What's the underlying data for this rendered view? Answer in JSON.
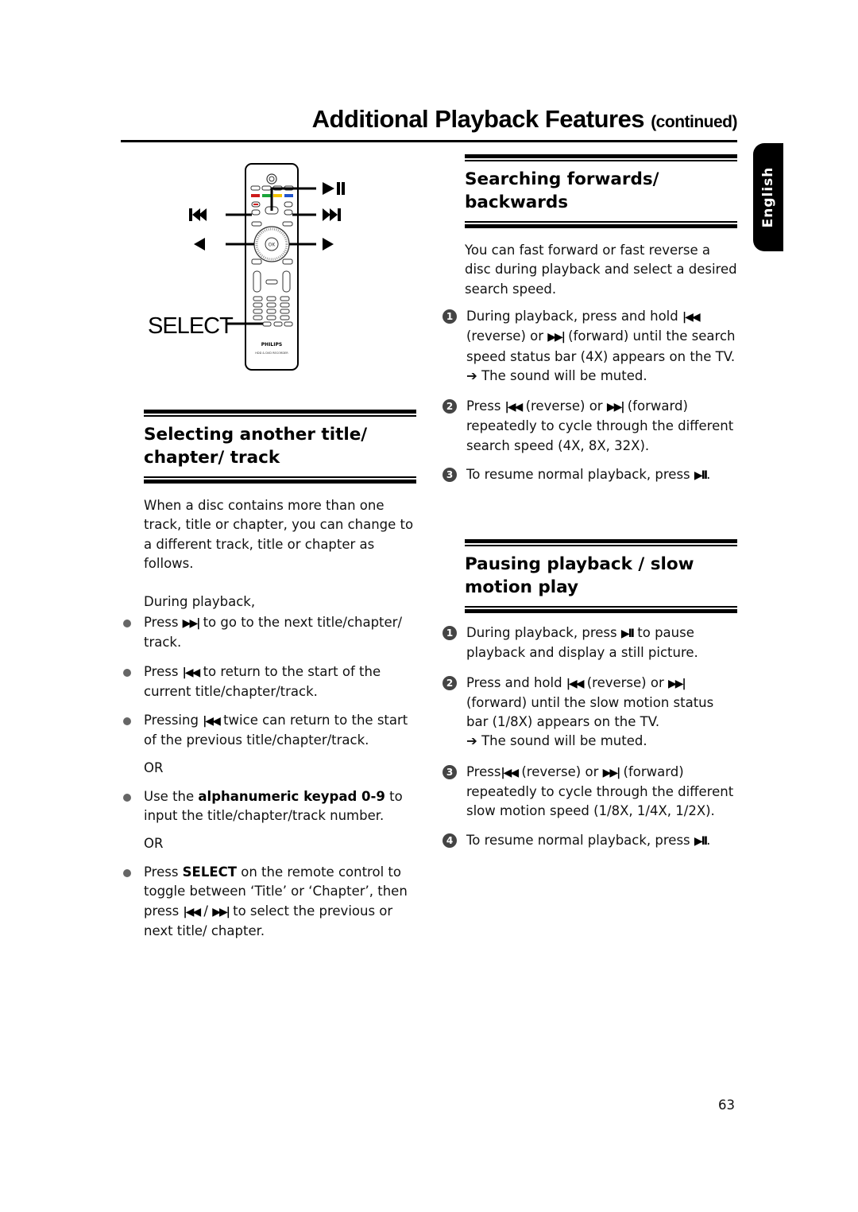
{
  "header": {
    "title": "Additional Playback Features",
    "title_suffix": "(continued)"
  },
  "language_tab": "English",
  "remote_figure": {
    "callouts": {
      "play_pause": "play-pause-icon",
      "prev": "previous-icon",
      "next": "next-icon",
      "left": "left-arrow-icon",
      "right": "right-arrow-icon",
      "select": "SELECT"
    },
    "brand": "PHILIPS",
    "model": "HDD & DVD RECORDER",
    "ok_label": "OK",
    "color_keys": [
      "#cc1a1a",
      "#1aa53a",
      "#f2c200",
      "#2255cc"
    ]
  },
  "left_section": {
    "heading_line1": "Selecting another title/",
    "heading_line2": "chapter/ track",
    "intro": "When a disc contains more than one track, title or chapter, you can change to a different track, title or chapter as follows.",
    "during": "During playback,",
    "bullets": [
      {
        "pre": "Press ",
        "icon": "next",
        "post": " to go to the next title/chapter/ track."
      },
      {
        "pre": "Press ",
        "icon": "prev",
        "post": "  to return to the start of the current title/chapter/track."
      },
      {
        "pre": "Pressing ",
        "icon": "prev",
        "post": "  twice can return to the start of the previous title/chapter/track."
      },
      {
        "pre": "Use the ",
        "bold": "alphanumeric keypad 0-9",
        "post": " to input the title/chapter/track number."
      },
      {
        "pre": "Press ",
        "bold": "SELECT",
        "post": " on the remote control to toggle between ‘Title’ or ‘Chapter’, then press ",
        "icon1": "prev",
        "mid": " / ",
        "icon2": "next",
        "post2": " to select the previous or next title/ chapter."
      }
    ],
    "or_label": "OR"
  },
  "right_section_1": {
    "heading_line1": "Searching forwards/",
    "heading_line2": "backwards",
    "intro": "You can fast forward or fast reverse a disc during playback and select a desired search speed.",
    "steps": [
      {
        "num": "1",
        "pre": "During playback, press and hold ",
        "icon1": "prev",
        "mid": " (reverse) or ",
        "icon2": "next",
        "post": " (forward) until the search speed status bar (4X) appears on the TV.",
        "note": "The sound will be muted."
      },
      {
        "num": "2",
        "pre": "Press ",
        "icon1": "prev",
        "mid": "  (reverse) or ",
        "icon2": "next",
        "post": " (forward) repeatedly to cycle through the different search speed (4X, 8X, 32X)."
      },
      {
        "num": "3",
        "pre": "To resume normal playback, press ",
        "icon1": "playpause",
        "post": "."
      }
    ]
  },
  "right_section_2": {
    "heading_line1": "Pausing playback / slow",
    "heading_line2": "motion play",
    "steps": [
      {
        "num": "1",
        "pre": "During playback, press ",
        "icon1": "playpause",
        "post": " to pause playback and display a still picture."
      },
      {
        "num": "2",
        "pre": "Press and hold ",
        "icon1": "prev",
        "mid": "  (reverse) or ",
        "icon2": "next",
        "post": " (forward) until the slow motion status bar (1/8X) appears on the TV.",
        "note": "The sound will be muted."
      },
      {
        "num": "3",
        "pre": "Press",
        "icon1": "prev",
        "mid": "  (reverse) or ",
        "icon2": "next",
        "post": " (forward) repeatedly to cycle through the different slow motion speed (1/8X, 1/4X, 1/2X)."
      },
      {
        "num": "4",
        "pre": "To resume normal playback, press ",
        "icon1": "playpause",
        "post": "."
      }
    ]
  },
  "icons": {
    "prev": "⏮",
    "next": "⏭",
    "playpause": "⏯",
    "arrow": "➔"
  },
  "page_number": "63"
}
